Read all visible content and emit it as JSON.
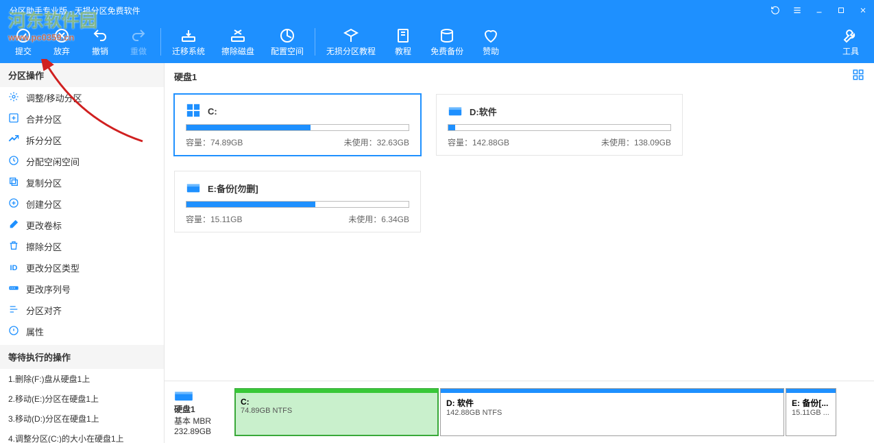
{
  "title": "分区助手专业版 - 无损分区免费软件",
  "toolbar": {
    "submit": "提交",
    "discard": "放弃",
    "undo": "撤销",
    "redo": "重做",
    "migrate": "迁移系统",
    "wipe": "擦除磁盘",
    "allocspace": "配置空间",
    "tutorial": "无损分区教程",
    "guide": "教程",
    "backup": "免费备份",
    "donate": "赞助",
    "tools": "工具"
  },
  "sidebar": {
    "ops_head": "分区操作",
    "items": [
      {
        "label": "调整/移动分区"
      },
      {
        "label": "合并分区"
      },
      {
        "label": "拆分分区"
      },
      {
        "label": "分配空闲空间"
      },
      {
        "label": "复制分区"
      },
      {
        "label": "创建分区"
      },
      {
        "label": "更改卷标"
      },
      {
        "label": "擦除分区"
      },
      {
        "label": "更改分区类型"
      },
      {
        "label": "更改序列号"
      },
      {
        "label": "分区对齐"
      },
      {
        "label": "属性"
      }
    ],
    "pending_head": "等待执行的操作",
    "pending": [
      "1.删除(F:)盘从硬盘1上",
      "2.移动(E:)分区在硬盘1上",
      "3.移动(D:)分区在硬盘1上",
      "4.调整分区(C:)的大小在硬盘1上"
    ]
  },
  "main": {
    "disk_title": "硬盘1",
    "cards": [
      {
        "name": "C:",
        "cap_label": "容量：",
        "cap": "74.89GB",
        "unused_label": "未使用：",
        "unused": "32.63GB",
        "fill": 56,
        "selected": true,
        "icon": "win"
      },
      {
        "name": "D:软件",
        "cap_label": "容量：",
        "cap": "142.88GB",
        "unused_label": "未使用：",
        "unused": "138.09GB",
        "fill": 3,
        "selected": false,
        "icon": "drive"
      },
      {
        "name": "E:备份[勿删]",
        "cap_label": "容量：",
        "cap": "15.11GB",
        "unused_label": "未使用：",
        "unused": "6.34GB",
        "fill": 58,
        "selected": false,
        "icon": "drive"
      }
    ]
  },
  "bottom": {
    "disk_name": "硬盘1",
    "disk_type": "基本 MBR",
    "disk_size": "232.89GB",
    "parts": [
      {
        "name": "C:",
        "info": "74.89GB NTFS",
        "cls": "c"
      },
      {
        "name": "D: 软件",
        "info": "142.88GB NTFS",
        "cls": "d"
      },
      {
        "name": "E: 备份[...",
        "info": "15.11GB ...",
        "cls": "e"
      }
    ]
  },
  "watermark": {
    "line1": "河东软件园",
    "line2": "www.pc0359.cn"
  }
}
